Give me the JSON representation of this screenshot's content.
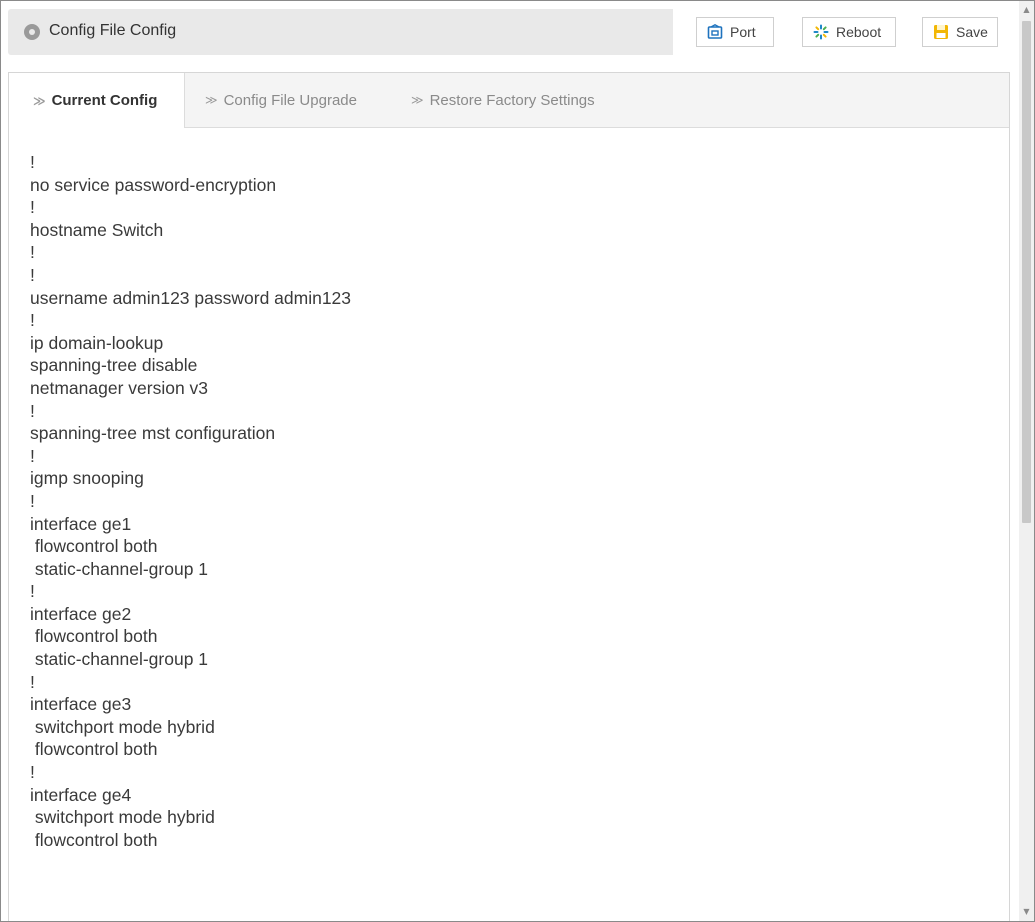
{
  "header": {
    "title": "Config File Config",
    "buttons": {
      "port": "Port",
      "reboot": "Reboot",
      "save": "Save"
    },
    "icons": {
      "title": "circle-dot-icon",
      "port": "port-icon",
      "reboot": "spinner-icon",
      "save": "floppy-icon"
    }
  },
  "tabs": [
    {
      "label": "Current Config",
      "active": true
    },
    {
      "label": "Config File Upgrade",
      "active": false
    },
    {
      "label": "Restore Factory Settings",
      "active": false
    }
  ],
  "config_text": "!\nno service password-encryption\n!\nhostname Switch\n!\n!\nusername admin123 password admin123\n!\nip domain-lookup\nspanning-tree disable\nnetmanager version v3\n!\nspanning-tree mst configuration\n!\nigmp snooping\n!\ninterface ge1\n flowcontrol both\n static-channel-group 1\n!\ninterface ge2\n flowcontrol both\n static-channel-group 1\n!\ninterface ge3\n switchport mode hybrid\n flowcontrol both\n!\ninterface ge4\n switchport mode hybrid\n flowcontrol both",
  "colors": {
    "header_bg": "#e9e9e9",
    "tab_bar_bg": "#f4f4f4",
    "text": "#3a3a3a",
    "reboot_icon": "#1e88c8",
    "save_icon": "#f2b705",
    "port_icon": "#1e73be"
  }
}
